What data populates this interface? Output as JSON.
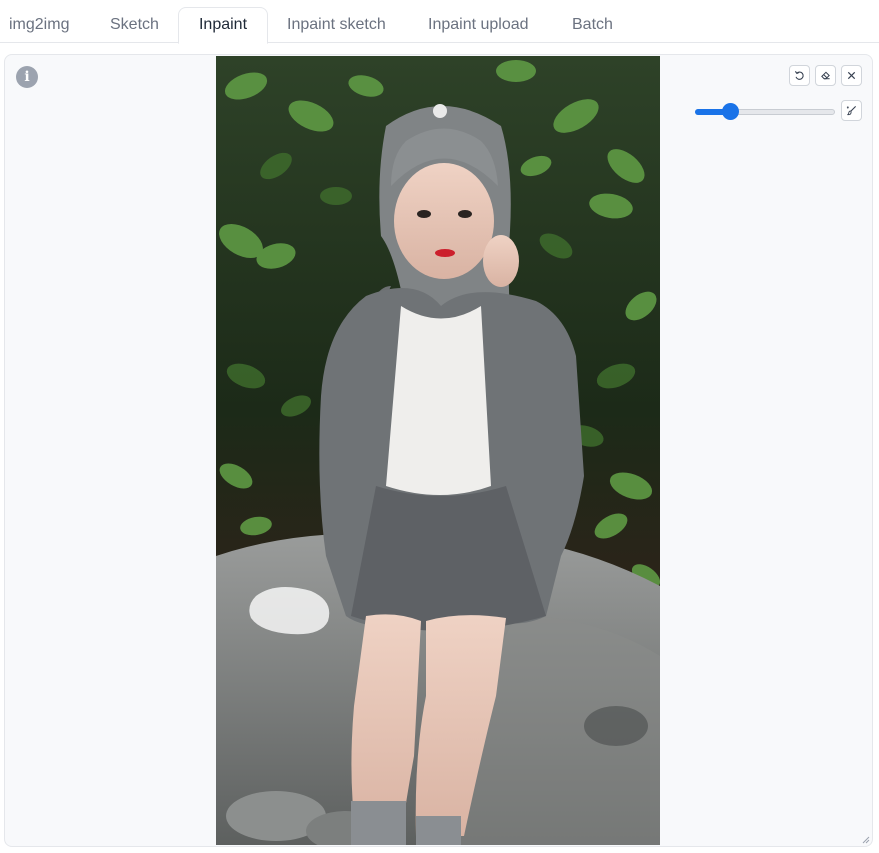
{
  "tabs": [
    {
      "label": "img2img",
      "active": false
    },
    {
      "label": "Sketch",
      "active": false
    },
    {
      "label": "Inpaint",
      "active": true
    },
    {
      "label": "Inpaint sketch",
      "active": false
    },
    {
      "label": "Inpaint upload",
      "active": false
    },
    {
      "label": "Batch",
      "active": false
    }
  ],
  "canvas": {
    "info_icon": "info-icon",
    "info_glyph": "i",
    "brush_size_value": 0.25,
    "tools": [
      "undo-icon",
      "eraser-icon",
      "close-icon",
      "brush-icon"
    ]
  },
  "colors": {
    "accent": "#1a73e8",
    "panel_bg": "#f8f9fb",
    "border": "#e5e7eb"
  }
}
